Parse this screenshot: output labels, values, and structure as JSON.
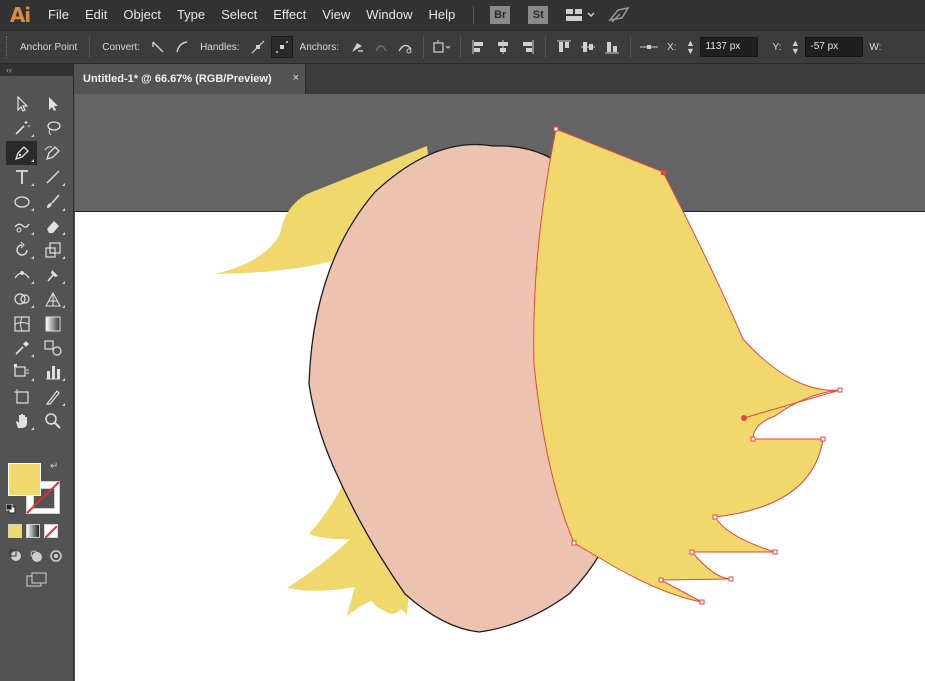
{
  "app": {
    "logo": "Ai"
  },
  "menu": {
    "items": [
      "File",
      "Edit",
      "Object",
      "Type",
      "Select",
      "Effect",
      "View",
      "Window",
      "Help"
    ],
    "bridge_badge": "Br",
    "stock_badge": "St"
  },
  "control": {
    "tool_name": "Anchor Point",
    "convert_label": "Convert:",
    "handles_label": "Handles:",
    "anchors_label": "Anchors:",
    "x_label": "X:",
    "x_value": "1137 px",
    "y_label": "Y:",
    "y_value": "-57 px",
    "w_label": "W:"
  },
  "document": {
    "tab_title": "Untitled-1* @ 66.67% (RGB/Preview)",
    "tab_close": "×"
  },
  "toolbox": {
    "collapse_glyph": "‹‹",
    "tools": [
      {
        "name": "selection-tool",
        "icon": "arrow-outline"
      },
      {
        "name": "direct-selection-tool",
        "icon": "arrow-solid"
      },
      {
        "name": "magic-wand-tool",
        "icon": "magic-wand"
      },
      {
        "name": "lasso-tool",
        "icon": "lasso"
      },
      {
        "name": "pen-tool",
        "icon": "pen",
        "selected": true
      },
      {
        "name": "curvature-tool",
        "icon": "curvature-pen"
      },
      {
        "name": "type-tool",
        "icon": "type-T"
      },
      {
        "name": "line-segment-tool",
        "icon": "line"
      },
      {
        "name": "ellipse-tool",
        "icon": "ellipse"
      },
      {
        "name": "paintbrush-tool",
        "icon": "brush"
      },
      {
        "name": "shaper-tool",
        "icon": "shaper"
      },
      {
        "name": "eraser-tool",
        "icon": "eraser"
      },
      {
        "name": "rotate-tool",
        "icon": "rotate"
      },
      {
        "name": "scale-tool",
        "icon": "scale"
      },
      {
        "name": "width-tool",
        "icon": "width"
      },
      {
        "name": "puppet-warp-tool",
        "icon": "pin"
      },
      {
        "name": "shape-builder-tool",
        "icon": "shape-builder"
      },
      {
        "name": "perspective-grid-tool",
        "icon": "perspective"
      },
      {
        "name": "mesh-tool",
        "icon": "mesh"
      },
      {
        "name": "gradient-tool",
        "icon": "gradient"
      },
      {
        "name": "eyedropper-tool",
        "icon": "eyedropper"
      },
      {
        "name": "blend-tool",
        "icon": "blend"
      },
      {
        "name": "symbol-sprayer-tool",
        "icon": "symbol-sprayer"
      },
      {
        "name": "column-graph-tool",
        "icon": "bar-graph"
      },
      {
        "name": "artboard-tool",
        "icon": "artboard"
      },
      {
        "name": "slice-tool",
        "icon": "slice"
      },
      {
        "name": "hand-tool",
        "icon": "hand"
      },
      {
        "name": "zoom-tool",
        "icon": "magnifier"
      }
    ],
    "fill_color": "#f0d86d",
    "stroke_color": "none"
  },
  "colors": {
    "hair": "#f0d86d",
    "skin": "#ecc2b0",
    "selection": "#e8453c"
  }
}
